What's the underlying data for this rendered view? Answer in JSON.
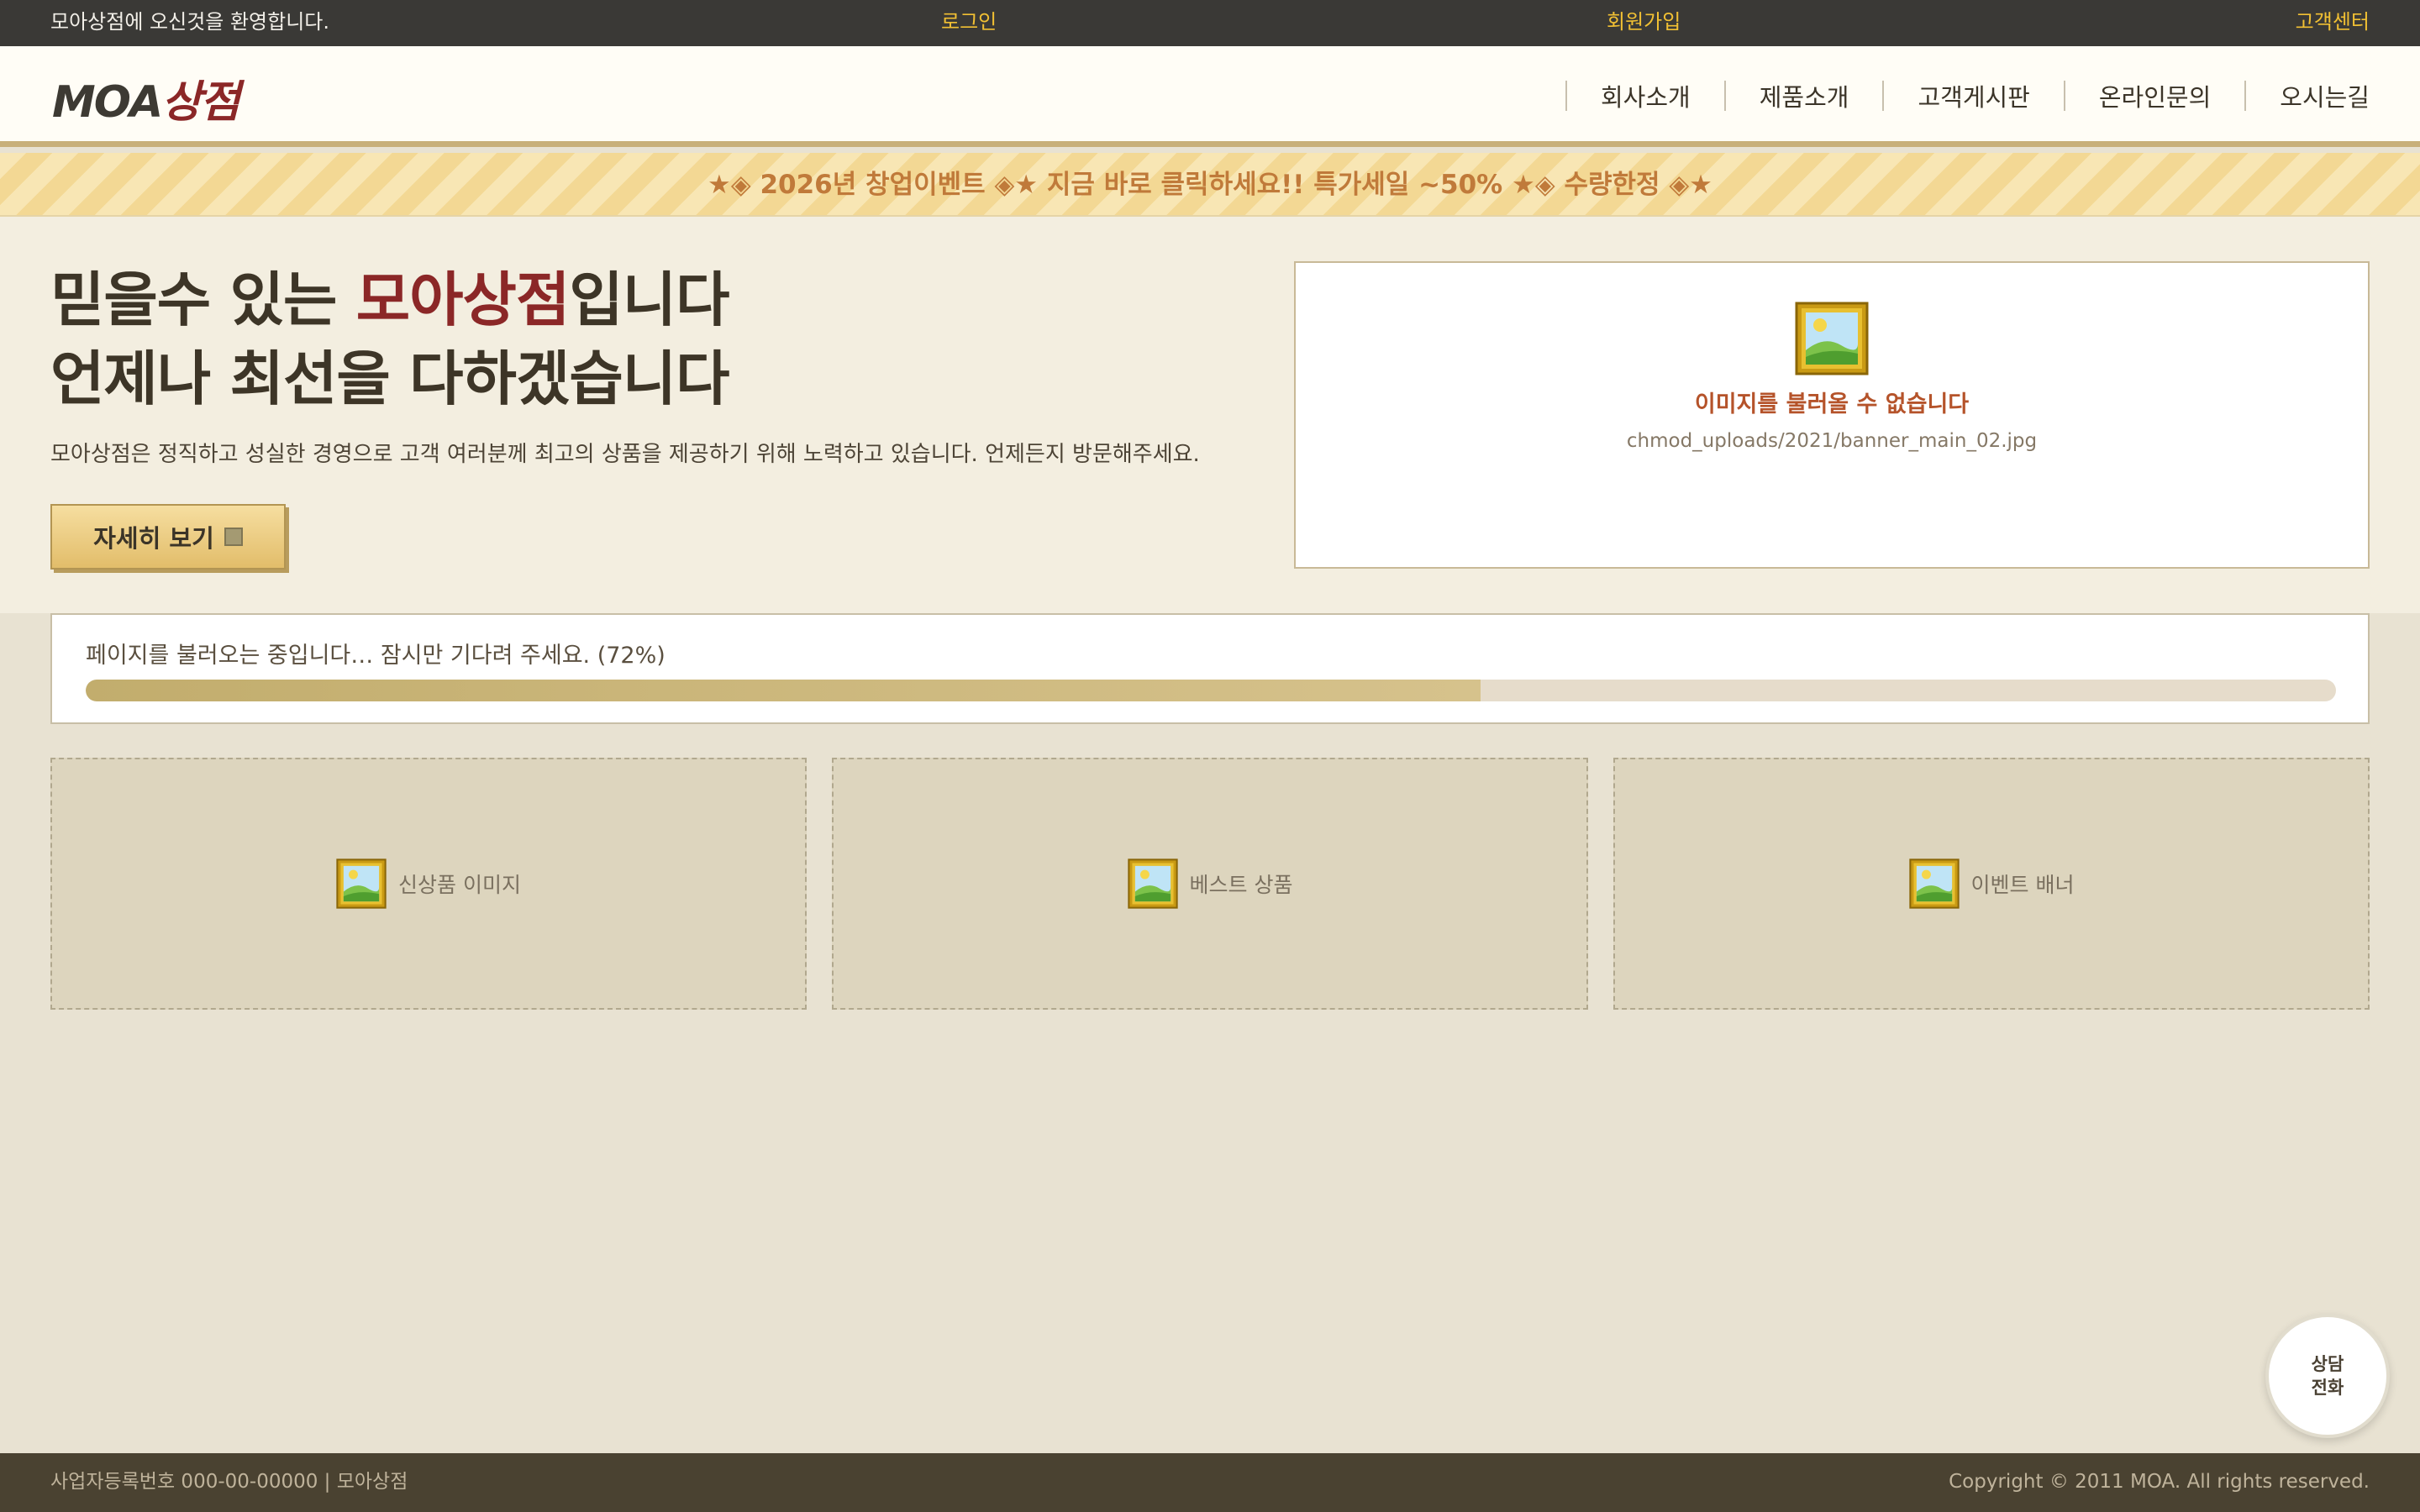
{
  "topbar": {
    "welcome": "모아상점에 오신것을 환영합니다.",
    "login": "로그인",
    "signup": "회원가입",
    "customer_center": "고객센터"
  },
  "header": {
    "logo_latin": "MOA",
    "logo_korean": "상점",
    "nav": [
      "회사소개",
      "제품소개",
      "고객게시판",
      "온라인문의",
      "오시는길"
    ]
  },
  "promo": {
    "text": "★◈ 2026년 창업이벤트 ◈★ 지금 바로 클릭하세요!! 특가세일 ~50% ★◈ 수량한정 ◈★"
  },
  "hero": {
    "line1_prefix": "믿을수 있는 ",
    "line1_accent": "모아상점",
    "line1_suffix": "입니다",
    "line2": "언제나 최선을 다하겠습니다",
    "description": "모아상점은 정직하고 성실한 경영으로 고객 여러분께 최고의 상품을 제공하기 위해 노력하고 있습니다. 언제든지 방문해주세요.",
    "button_label": "자세히 보기",
    "broken_image": {
      "title": "이미지를 불러올 수 없습니다",
      "path": "chmod_uploads/2021/banner_main_02.jpg",
      "icon": "picture-frame-icon"
    }
  },
  "loader": {
    "message": "페이지를 불러오는 중입니다… 잠시만 기다려 주세요. (72%)",
    "progress_percent": 62
  },
  "cards": [
    {
      "label": "신상품 이미지",
      "icon": "picture-frame-icon"
    },
    {
      "label": "베스트 상품",
      "icon": "picture-frame-icon"
    },
    {
      "label": "이벤트 배너",
      "icon": "picture-frame-icon"
    }
  ],
  "call_button": {
    "line1": "상담",
    "line2": "전화"
  },
  "footer": {
    "business": "사업자등록번호 000-00-00000 | 모아상점",
    "copyright": "Copyright © 2011 MOA. All rights reserved."
  },
  "colors": {
    "accent_red": "#8b2727",
    "topbar_link": "#f1c033",
    "promo_text": "#c07a3a",
    "progress_fill": "#c2ad6d"
  }
}
